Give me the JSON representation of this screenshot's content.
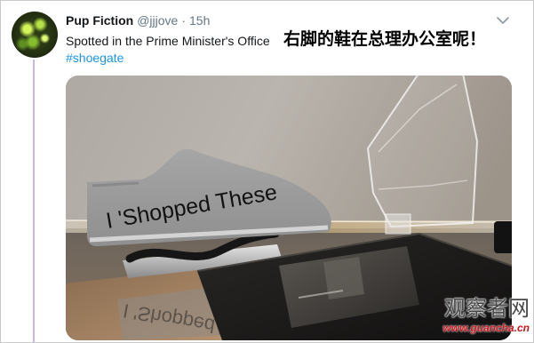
{
  "tweet": {
    "author": {
      "name": "Pup Fiction",
      "handle": "@jjjove"
    },
    "separator": "·",
    "time": "15h",
    "text": "Spotted in the Prime Minister's Office",
    "hashtag": "#shoegate",
    "menu_icon": "chevron-down-icon"
  },
  "overlay_caption": "右脚的鞋在总理办公室呢！",
  "photo": {
    "shoe_caption": "I 'Shopped These"
  },
  "watermark": {
    "name": "观察者网",
    "url": "www.guancha.cn"
  },
  "colors": {
    "author_name": "#14171a",
    "secondary_text": "#657786",
    "hashtag_link": "#1b95e0",
    "thread_line": "#cbb6e5",
    "watermark_url": "#c8161d"
  }
}
